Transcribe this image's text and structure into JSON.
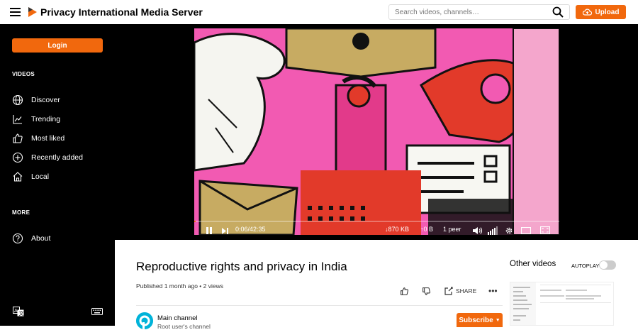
{
  "header": {
    "app_title": "Privacy International Media Server",
    "search": {
      "placeholder": "Search videos, channels…",
      "icon": "search-icon"
    },
    "upload_label": "Upload",
    "accent_color": "#f1680d"
  },
  "sidebar": {
    "login_label": "Login",
    "videos_section": "VIDEOS",
    "items": [
      {
        "label": "Discover",
        "icon": "globe-icon"
      },
      {
        "label": "Trending",
        "icon": "trending-icon"
      },
      {
        "label": "Most liked",
        "icon": "thumbs-up-icon"
      },
      {
        "label": "Recently added",
        "icon": "plus-circle-icon"
      },
      {
        "label": "Local",
        "icon": "home-icon"
      }
    ],
    "more_section": "MORE",
    "about": {
      "label": "About",
      "icon": "help-circle-icon"
    }
  },
  "player": {
    "time": "0:06/42:35",
    "download": "870 KB",
    "upload": "0 B",
    "peers": "1 peer",
    "progress": 0.002
  },
  "video": {
    "title": "Reproductive rights and privacy in India",
    "meta": "Published 1 month ago • 2 views",
    "share_label": "SHARE",
    "channel_name": "Main channel",
    "channel_sub": "Root user's channel",
    "subscribe_label": "Subscribe"
  },
  "right": {
    "other_videos": "Other videos",
    "autoplay": "AUTOPLAY"
  }
}
